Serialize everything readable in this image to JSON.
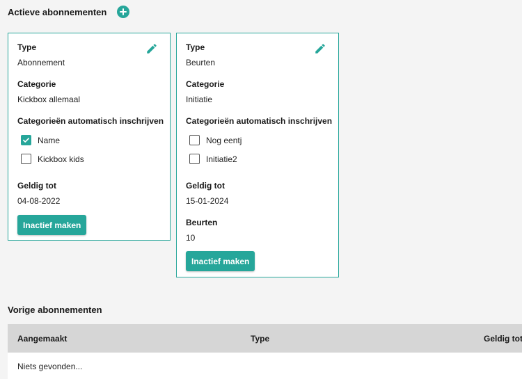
{
  "active": {
    "title": "Actieve abonnementen",
    "cards": [
      {
        "type_label": "Type",
        "type_value": "Abonnement",
        "category_label": "Categorie",
        "category_value": "Kickbox allemaal",
        "auto_label": "Categorieën automatisch inschrijven",
        "auto_items": [
          {
            "label": "Name",
            "checked": true
          },
          {
            "label": "Kickbox kids",
            "checked": false
          }
        ],
        "valid_label": "Geldig tot",
        "valid_value": "04-08-2022",
        "button_label": "Inactief maken"
      },
      {
        "type_label": "Type",
        "type_value": "Beurten",
        "category_label": "Categorie",
        "category_value": "Initiatie",
        "auto_label": "Categorieën automatisch inschrijven",
        "auto_items": [
          {
            "label": "Nog eentj",
            "checked": false
          },
          {
            "label": "Initiatie2",
            "checked": false
          }
        ],
        "valid_label": "Geldig tot",
        "valid_value": "15-01-2024",
        "turns_label": "Beurten",
        "turns_value": "10",
        "button_label": "Inactief maken"
      }
    ]
  },
  "previous": {
    "title": "Vorige abonnementen",
    "columns": [
      "Aangemaakt",
      "Type",
      "Geldig tot"
    ],
    "empty_text": "Niets gevonden..."
  },
  "colors": {
    "accent": "#26a69a",
    "background": "#f4f4f4",
    "table_header": "#d6d6d6"
  },
  "icons": {
    "add": "plus-circle-icon",
    "edit": "pencil-icon",
    "check": "checkmark-icon"
  }
}
